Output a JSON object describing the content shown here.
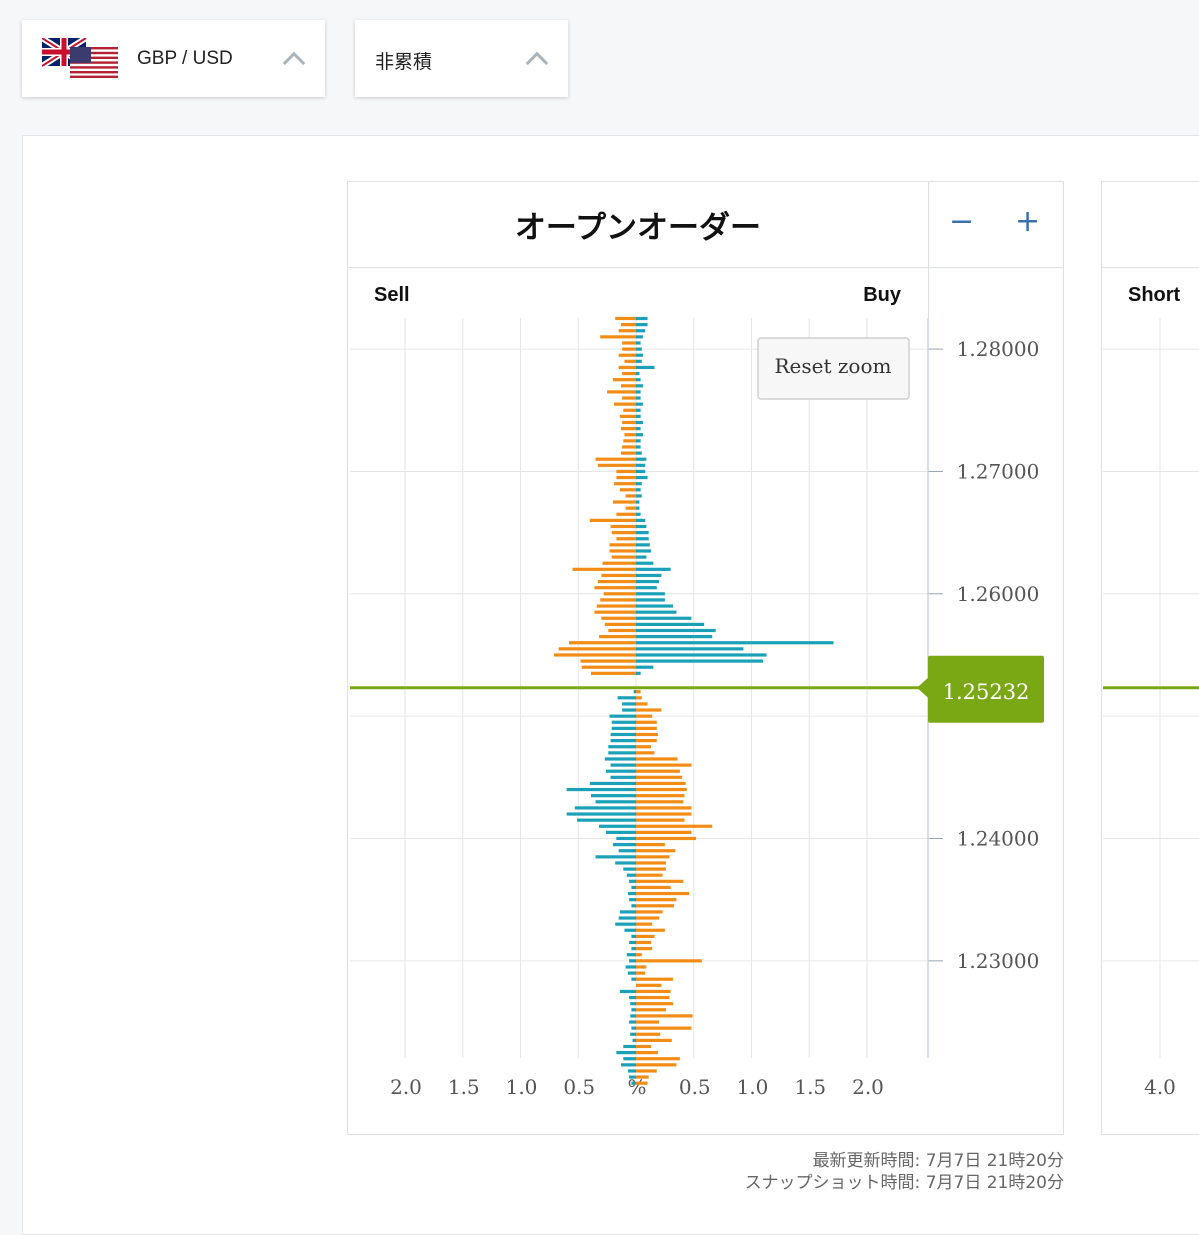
{
  "selectors": {
    "pair": "GBP / USD",
    "mode": "非累積"
  },
  "panel": {
    "title": "オープンオーダー",
    "zoom_out": "−",
    "zoom_in": "+",
    "sell_label": "Sell",
    "buy_label": "Buy",
    "reset_zoom": "Reset zoom"
  },
  "panel2": {
    "short_label": "Short",
    "x_tick": "4.0"
  },
  "footer": {
    "updated": "最新更新時間: 7月7日 21時20分",
    "snapshot": "スナップショット時間: 7月7日 21時20分"
  },
  "colors": {
    "sell": "#f28c14",
    "buy": "#1aa1b8",
    "current_price": "#7aa815",
    "grid": "#e6e6e6"
  },
  "chart_data": {
    "type": "bar",
    "orientation": "horizontal",
    "ylabel": "",
    "xlabel": "%",
    "x_ticks": [
      "2.0",
      "1.5",
      "1.0",
      "0.5",
      "%",
      "0.5",
      "1.0",
      "1.5",
      "2.0"
    ],
    "xlim": [
      -2.5,
      2.5
    ],
    "y_ticks": [
      "1.28000",
      "1.27000",
      "1.26000",
      "1.24000",
      "1.23000"
    ],
    "y_tick_values": [
      1.28,
      1.27,
      1.26,
      1.24,
      1.23
    ],
    "ylim": [
      1.2219,
      1.2826
    ],
    "current_price": 1.25232,
    "current_price_label": "1.25232",
    "price_step": 0.0005,
    "above_start_price": 1.2825,
    "above_left_series": "Sell (orange)",
    "above_right_series": "Buy (teal)",
    "above_left": [
      0.18,
      0.13,
      0.15,
      0.31,
      0.12,
      0.12,
      0.15,
      0.1,
      0.15,
      0.12,
      0.2,
      0.13,
      0.25,
      0.12,
      0.19,
      0.11,
      0.14,
      0.12,
      0.13,
      0.1,
      0.11,
      0.12,
      0.13,
      0.35,
      0.33,
      0.17,
      0.17,
      0.19,
      0.14,
      0.09,
      0.2,
      0.09,
      0.17,
      0.4,
      0.22,
      0.21,
      0.17,
      0.23,
      0.23,
      0.21,
      0.29,
      0.55,
      0.3,
      0.33,
      0.36,
      0.28,
      0.31,
      0.34,
      0.36,
      0.3,
      0.27,
      0.24,
      0.32,
      0.58,
      0.67,
      0.71,
      0.48,
      0.47,
      0.39
    ],
    "above_right": [
      0.1,
      0.1,
      0.08,
      0.06,
      0.04,
      0.05,
      0.06,
      0.05,
      0.16,
      0.03,
      0.04,
      0.06,
      0.04,
      0.04,
      0.06,
      0.04,
      0.04,
      0.06,
      0.04,
      0.06,
      0.04,
      0.04,
      0.05,
      0.09,
      0.08,
      0.08,
      0.1,
      0.05,
      0.04,
      0.05,
      0.03,
      0.03,
      0.04,
      0.08,
      0.09,
      0.11,
      0.11,
      0.12,
      0.13,
      0.09,
      0.15,
      0.3,
      0.22,
      0.2,
      0.18,
      0.25,
      0.25,
      0.32,
      0.35,
      0.48,
      0.59,
      0.69,
      0.66,
      1.71,
      0.93,
      1.13,
      1.1,
      0.15,
      0.04
    ],
    "below_start_price": 1.252,
    "below_left_series": "Buy (teal)",
    "below_right_series": "Sell (orange)",
    "below_left": [
      0.02,
      0.16,
      0.12,
      0.12,
      0.23,
      0.21,
      0.21,
      0.22,
      0.22,
      0.24,
      0.24,
      0.27,
      0.22,
      0.26,
      0.22,
      0.4,
      0.6,
      0.39,
      0.35,
      0.53,
      0.6,
      0.51,
      0.32,
      0.26,
      0.17,
      0.2,
      0.15,
      0.35,
      0.18,
      0.11,
      0.08,
      0.06,
      0.04,
      0.07,
      0.06,
      0.04,
      0.14,
      0.15,
      0.18,
      0.1,
      0.04,
      0.06,
      0.04,
      0.08,
      0.06,
      0.09,
      0.07,
      0.04,
      0.0,
      0.14,
      0.06,
      0.05,
      0.04,
      0.05,
      0.06,
      0.04,
      0.05,
      0.03,
      0.11,
      0.17,
      0.11,
      0.13,
      0.07,
      0.06,
      0.04
    ],
    "below_right": [
      0.04,
      0.05,
      0.1,
      0.22,
      0.14,
      0.18,
      0.18,
      0.19,
      0.18,
      0.13,
      0.16,
      0.36,
      0.48,
      0.38,
      0.4,
      0.43,
      0.44,
      0.42,
      0.41,
      0.48,
      0.48,
      0.42,
      0.66,
      0.48,
      0.52,
      0.25,
      0.34,
      0.29,
      0.26,
      0.26,
      0.23,
      0.41,
      0.3,
      0.46,
      0.35,
      0.33,
      0.23,
      0.2,
      0.14,
      0.25,
      0.16,
      0.13,
      0.14,
      0.05,
      0.57,
      0.09,
      0.08,
      0.32,
      0.22,
      0.3,
      0.29,
      0.32,
      0.26,
      0.49,
      0.2,
      0.48,
      0.21,
      0.31,
      0.13,
      0.19,
      0.38,
      0.35,
      0.18,
      0.11,
      0.1
    ]
  }
}
